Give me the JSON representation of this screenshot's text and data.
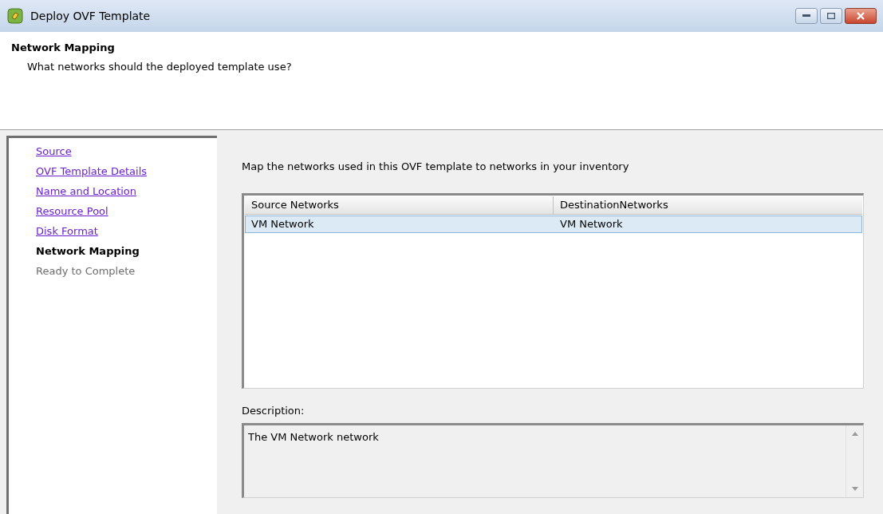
{
  "window": {
    "title": "Deploy OVF Template"
  },
  "header": {
    "title": "Network Mapping",
    "subtitle": "What networks should the deployed template use?"
  },
  "steps": [
    {
      "label": "Source",
      "kind": "done"
    },
    {
      "label": "OVF Template Details",
      "kind": "done"
    },
    {
      "label": "Name and Location",
      "kind": "done"
    },
    {
      "label": "Resource Pool",
      "kind": "done"
    },
    {
      "label": "Disk Format",
      "kind": "done"
    },
    {
      "label": "Network Mapping",
      "kind": "current"
    },
    {
      "label": "Ready to Complete",
      "kind": "pending"
    }
  ],
  "instruction": "Map the networks used in this OVF template to networks in your inventory",
  "table": {
    "columns": [
      "Source Networks",
      "DestinationNetworks"
    ],
    "rows": [
      {
        "cells": [
          "VM Network",
          "VM Network"
        ],
        "selected": true
      }
    ]
  },
  "description": {
    "label": "Description:",
    "value": "The VM Network network"
  }
}
